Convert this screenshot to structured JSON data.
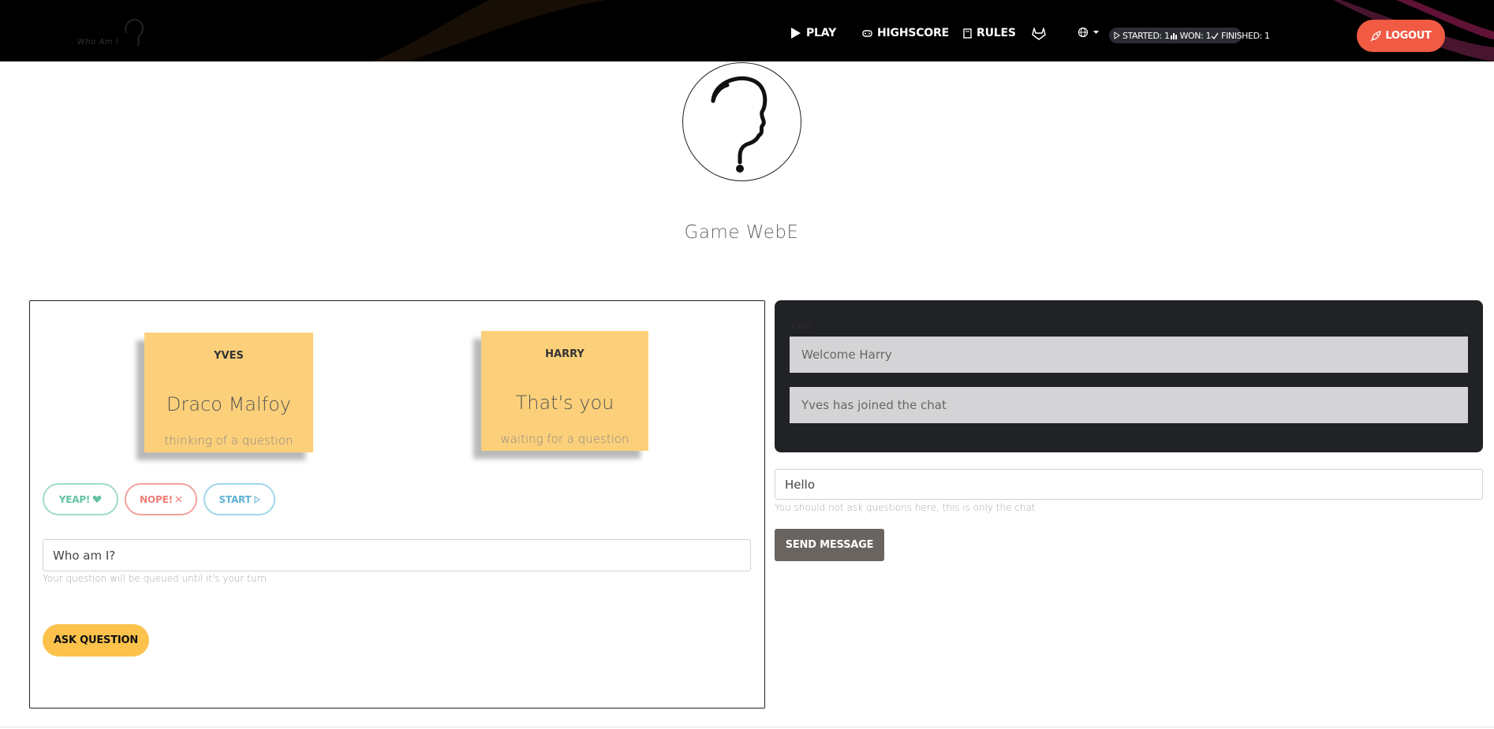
{
  "nav": {
    "brand_text": "Who Am I",
    "play_label": "PLAY",
    "highscore_label": "HIGHSCORE",
    "rules_label": "RULES",
    "stats": {
      "started": "STARTED: 1",
      "won": "WON: 1",
      "finished": "FINISHED: 1"
    },
    "logout_label": "LOGOUT",
    "accent_color": "#f15a43"
  },
  "game": {
    "title": "Game WebE",
    "players": [
      {
        "name": "YVES",
        "character": "Draco Malfoy",
        "status": "thinking of a question"
      },
      {
        "name": "HARRY",
        "character": "That's you",
        "status": "waiting for a question"
      }
    ],
    "answer_buttons": {
      "yeap": "YEAP!",
      "nope": "NOPE!",
      "start": "START"
    },
    "question_input_value": "Who am I?",
    "question_help": "Your question will be queued until it's your turn",
    "ask_label": "ASK QUESTION"
  },
  "chat": {
    "label": "Chat",
    "messages": [
      "Welcome Harry",
      "Yves has joined the chat"
    ],
    "input_value": "Hello",
    "help": "You should not ask questions here, this is only the chat",
    "send_label": "SEND MESSAGE"
  }
}
